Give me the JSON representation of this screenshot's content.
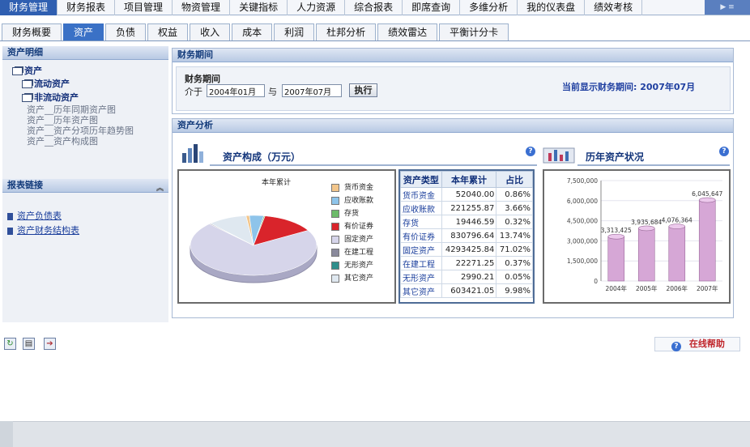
{
  "top_nav": [
    "财务管理",
    "财务报表",
    "项目管理",
    "物资管理",
    "关键指标",
    "人力资源",
    "综合报表",
    "即席查询",
    "多维分析",
    "我的仪表盘",
    "绩效考核"
  ],
  "top_nav_active": 0,
  "sub_tabs": [
    "财务概要",
    "资产",
    "负债",
    "权益",
    "收入",
    "成本",
    "利润",
    "杜邦分析",
    "绩效雷达",
    "平衡计分卡"
  ],
  "sub_tab_active": 1,
  "left": {
    "asset_detail_title": "资产明细",
    "tree": {
      "root": "资产",
      "current": "流动资产",
      "noncurrent": "非流动资产",
      "links": [
        "资产__历年同期资产图",
        "资产__历年资产图",
        "资产__资产分项历年趋势图",
        "资产__资产构成图"
      ]
    },
    "report_links_title": "报表链接",
    "report_links": [
      "资产负债表",
      "资产财务结构表"
    ]
  },
  "period": {
    "section_title": "财务期间",
    "label": "财务期间",
    "between": "介于",
    "start": "2004年01月",
    "and": "与",
    "end": "2007年07月",
    "run_button": "执行",
    "current_label": "当前显示财务期间:",
    "current_value": "2007年07月"
  },
  "analysis": {
    "section_title": "资产分析",
    "composition_title": "资产构成（万元）",
    "history_title": "历年资产状况",
    "pie_title": "本年累计",
    "table_headers": [
      "资产类型",
      "本年累计",
      "占比"
    ],
    "rows": [
      {
        "type": "货币资金",
        "value": "52040.00",
        "pct": "0.86%"
      },
      {
        "type": "应收账款",
        "value": "221255.87",
        "pct": "3.66%"
      },
      {
        "type": "存货",
        "value": "19446.59",
        "pct": "0.32%"
      },
      {
        "type": "有价证券",
        "value": "830796.64",
        "pct": "13.74%"
      },
      {
        "type": "固定资产",
        "value": "4293425.84",
        "pct": "71.02%"
      },
      {
        "type": "在建工程",
        "value": "22271.25",
        "pct": "0.37%"
      },
      {
        "type": "无形资产",
        "value": "2990.21",
        "pct": "0.05%"
      },
      {
        "type": "其它资产",
        "value": "603421.05",
        "pct": "9.98%"
      }
    ],
    "legend": [
      "货币资金",
      "应收账款",
      "存货",
      "有价证券",
      "固定资产",
      "在建工程",
      "无形资产",
      "其它资产"
    ]
  },
  "colors": {
    "pie": [
      "#f3c68b",
      "#8ec4ea",
      "#6dbb6a",
      "#d9242b",
      "#d6d5ea",
      "#8a8a9c",
      "#2f8f8c",
      "#dfe8f0"
    ],
    "bar": "#d6a7d6",
    "accent": "#2f5fb1"
  },
  "chart_data": [
    {
      "type": "pie",
      "title": "本年累计",
      "categories": [
        "货币资金",
        "应收账款",
        "存货",
        "有价证券",
        "固定资产",
        "在建工程",
        "无形资产",
        "其它资产"
      ],
      "values": [
        0.86,
        3.66,
        0.32,
        13.74,
        71.02,
        0.37,
        0.05,
        9.98
      ]
    },
    {
      "type": "bar",
      "categories": [
        "2004年",
        "2005年",
        "2006年",
        "2007年"
      ],
      "values": [
        3313425,
        3935684,
        4076364,
        6045647
      ],
      "value_labels": [
        "3,313,425",
        "3,935,684",
        "4,076,364",
        "6,045,647"
      ],
      "ylim": [
        0,
        7500000
      ],
      "yticks": [
        "0",
        "1,500,000",
        "3,000,000",
        "4,500,000",
        "6,000,000",
        "7,500,000"
      ]
    }
  ],
  "bottom": {
    "online_help": "在线帮助"
  },
  "icons": [
    "refresh-icon",
    "print-icon",
    "export-icon",
    "help-icon",
    "folder-icon",
    "document-icon",
    "chart-icon",
    "scroll-up-icon"
  ]
}
